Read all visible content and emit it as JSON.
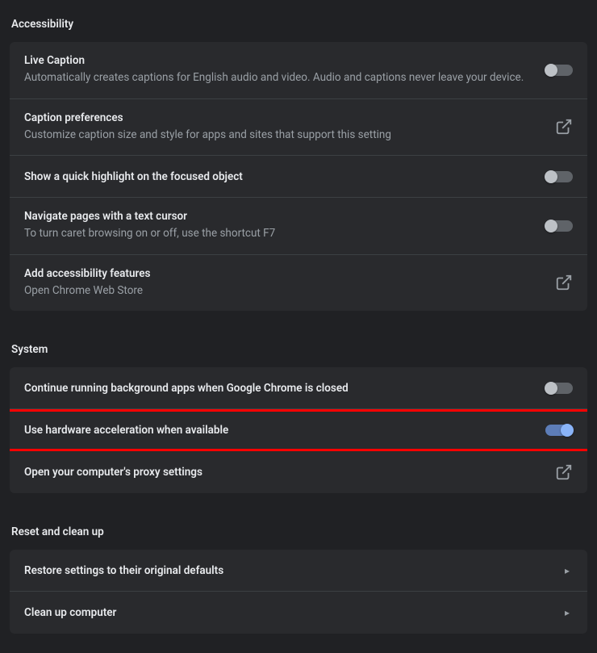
{
  "accessibility": {
    "header": "Accessibility",
    "items": [
      {
        "title": "Live Caption",
        "desc": "Automatically creates captions for English audio and video. Audio and captions never leave your device.",
        "control": "toggle",
        "on": false
      },
      {
        "title": "Caption preferences",
        "desc": "Customize caption size and style for apps and sites that support this setting",
        "control": "external"
      },
      {
        "title": "Show a quick highlight on the focused object",
        "control": "toggle",
        "on": false
      },
      {
        "title": "Navigate pages with a text cursor",
        "desc": "To turn caret browsing on or off, use the shortcut F7",
        "control": "toggle",
        "on": false
      },
      {
        "title": "Add accessibility features",
        "desc": "Open Chrome Web Store",
        "control": "external"
      }
    ]
  },
  "system": {
    "header": "System",
    "items": [
      {
        "title": "Continue running background apps when Google Chrome is closed",
        "control": "toggle",
        "on": false
      },
      {
        "title": "Use hardware acceleration when available",
        "control": "toggle",
        "on": true,
        "highlight": true
      },
      {
        "title": "Open your computer's proxy settings",
        "control": "external"
      }
    ]
  },
  "reset": {
    "header": "Reset and clean up",
    "items": [
      {
        "title": "Restore settings to their original defaults",
        "control": "arrow"
      },
      {
        "title": "Clean up computer",
        "control": "arrow"
      }
    ]
  }
}
